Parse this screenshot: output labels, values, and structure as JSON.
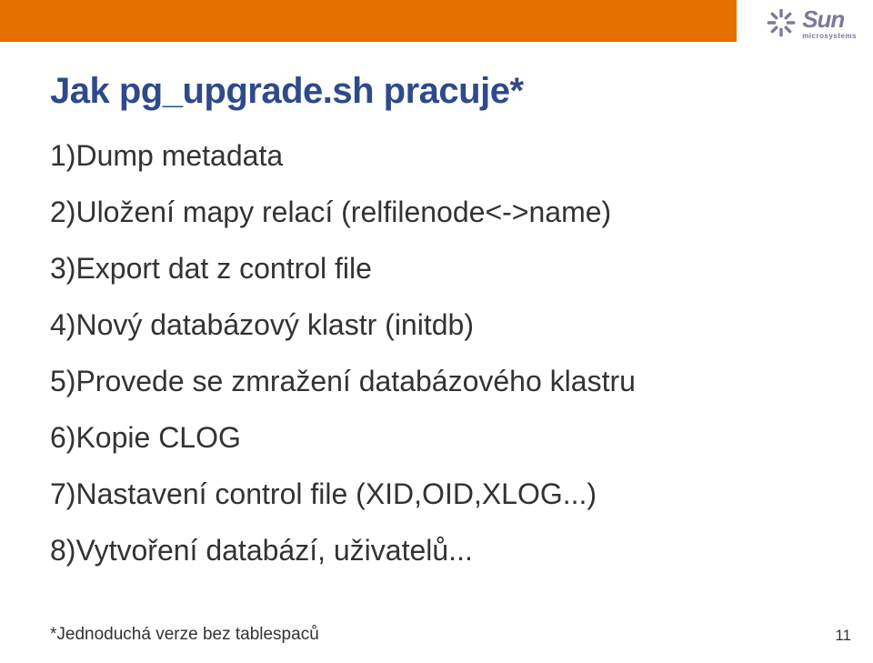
{
  "logo": {
    "brand": "Sun",
    "sub": "microsystems"
  },
  "title": "Jak pg_upgrade.sh pracuje*",
  "items": [
    "1)Dump metadata",
    "2)Uložení mapy relací (relfilenode<->name)",
    "3)Export dat z control file",
    "4)Nový databázový klastr (initdb)",
    "5)Provede se zmražení databázového klastru",
    "6)Kopie CLOG",
    "7)Nastavení control file (XID,OID,XLOG...)",
    "8)Vytvoření databází, uživatelů..."
  ],
  "footnote": "*Jednoduchá verze bez tablespaců",
  "pagenum": "11"
}
